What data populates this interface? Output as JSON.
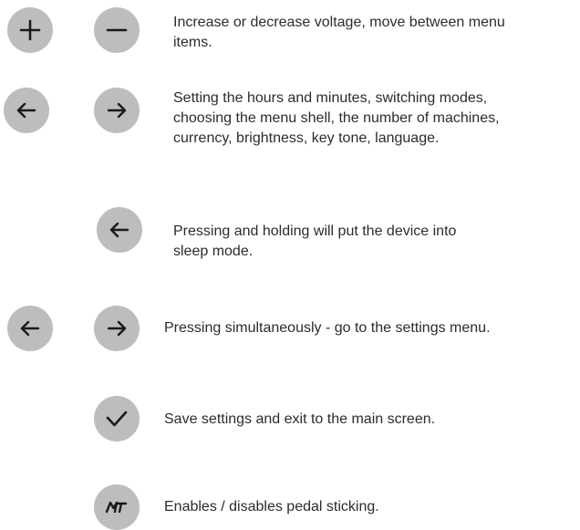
{
  "rows": [
    {
      "icons": [
        "plus-icon",
        "minus-icon"
      ],
      "lines": [
        "Increase or decrease voltage, move between menu",
        "items."
      ]
    },
    {
      "icons": [
        "arrow-left-icon",
        "arrow-right-icon"
      ],
      "lines": [
        "Setting the hours and minutes, switching modes,",
        "choosing the menu shell, the number of machines,",
        "currency, brightness, key tone, language."
      ]
    },
    {
      "icons": [
        "arrow-left-icon"
      ],
      "lines": [
        "Pressing and holding will put the device into",
        "sleep mode."
      ]
    },
    {
      "icons": [
        "arrow-left-icon",
        "arrow-right-icon"
      ],
      "lines": [
        "Pressing simultaneously - go to the settings menu."
      ]
    },
    {
      "icons": [
        "checkmark-icon"
      ],
      "lines": [
        "Save settings and exit to the main screen."
      ]
    },
    {
      "icons": [
        "mt-logo-icon"
      ],
      "logo_text": "MT",
      "lines": [
        "Enables / disables pedal sticking."
      ]
    }
  ],
  "colors": {
    "button_fill": "#bdbdbd",
    "icon_stroke": "#1a1a1a",
    "text": "#2c2c2c"
  }
}
